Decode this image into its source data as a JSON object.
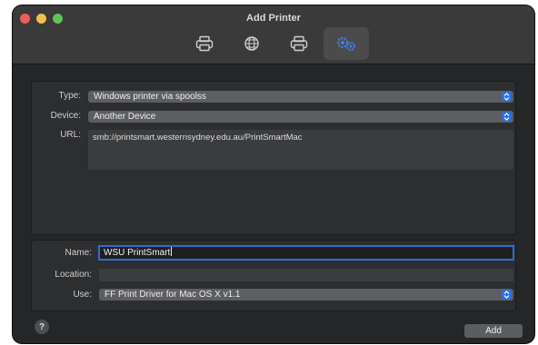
{
  "window": {
    "title": "Add Printer"
  },
  "toolbar": {
    "buttons": [
      {
        "icon": "default-printer-icon",
        "active": false
      },
      {
        "icon": "ip-globe-icon",
        "active": false
      },
      {
        "icon": "windows-printer-icon",
        "active": false
      },
      {
        "icon": "advanced-gears-icon",
        "active": true
      }
    ]
  },
  "form": {
    "type_label": "Type:",
    "type_value": "Windows printer via spoolss",
    "device_label": "Device:",
    "device_value": "Another Device",
    "url_label": "URL:",
    "url_value": "smb://printsmart.westernsydney.edu.au/PrintSmartMac",
    "name_label": "Name:",
    "name_value": "WSU PrintSmart",
    "location_label": "Location:",
    "location_value": "",
    "use_label": "Use:",
    "use_value": "FF Print Driver for Mac OS X v1.1"
  },
  "footer": {
    "help_label": "?",
    "add_label": "Add"
  },
  "colors": {
    "accent": "#2f6fe0",
    "window_bg": "#252627",
    "titlebar_bg": "#3a3a3b"
  }
}
